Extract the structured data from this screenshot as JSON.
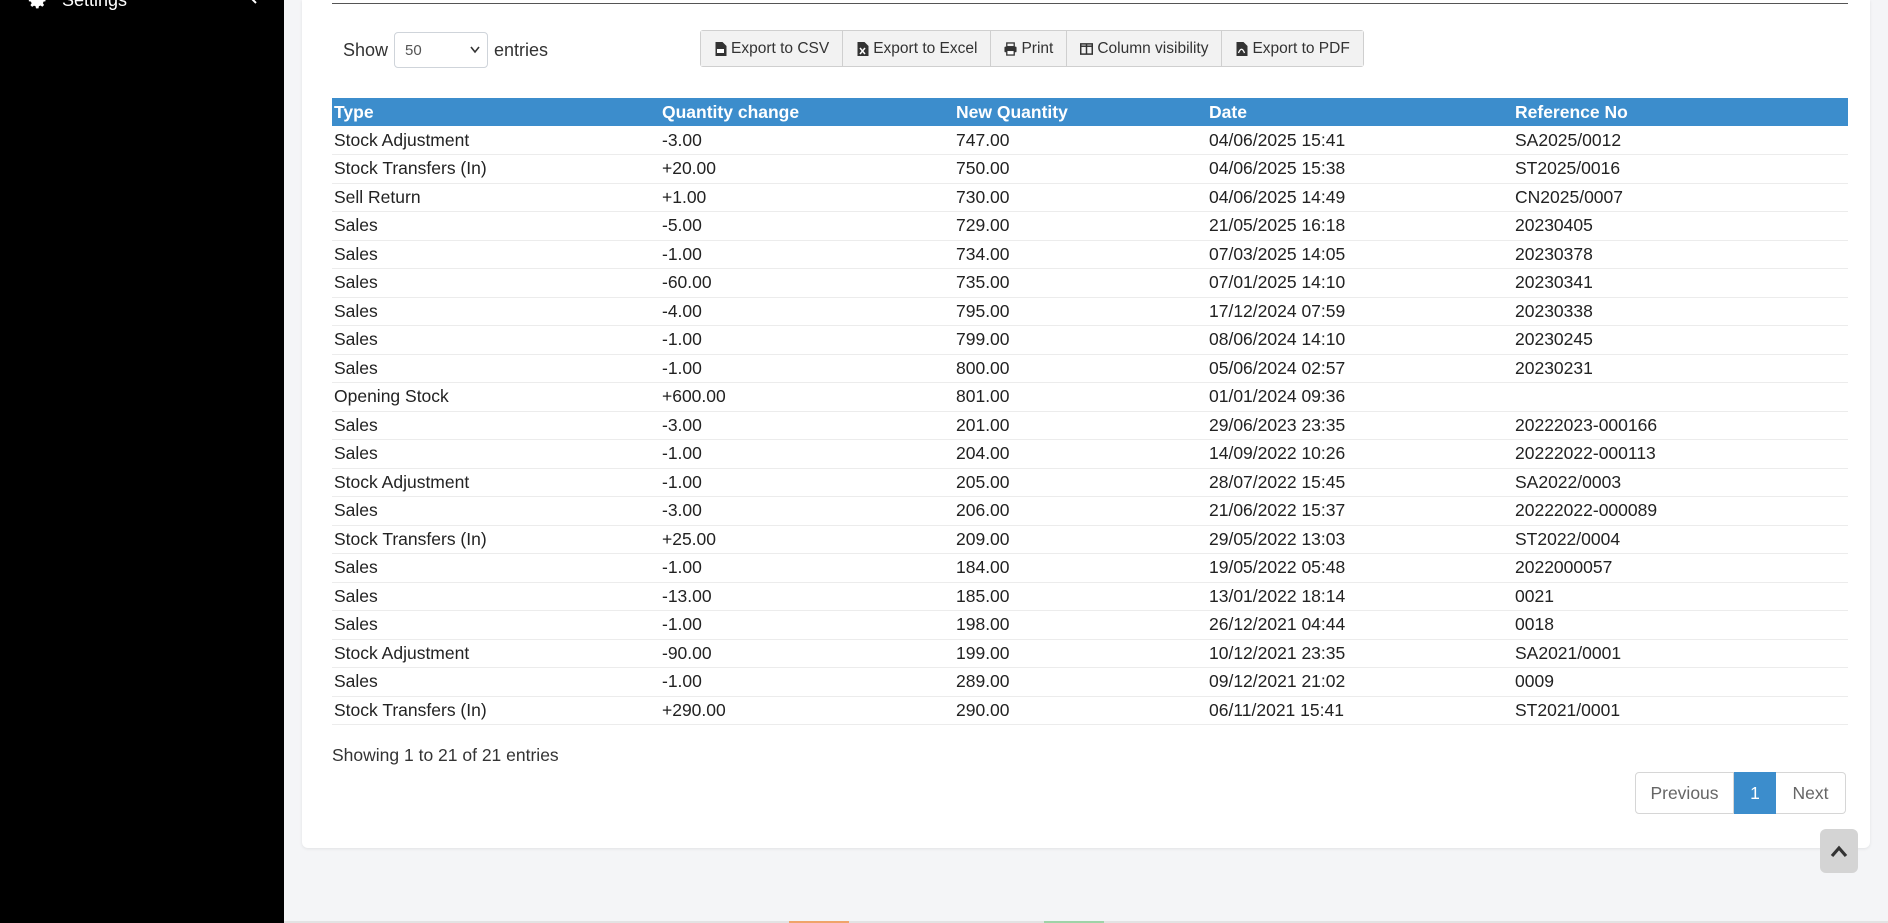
{
  "sidebar": {
    "settings_label": "Settings"
  },
  "table_controls": {
    "show_label": "Show",
    "entries_label": "entries",
    "page_length": "50"
  },
  "export_buttons": {
    "csv": "Export to CSV",
    "excel": "Export to Excel",
    "print": "Print",
    "column_visibility": "Column visibility",
    "pdf": "Export to PDF"
  },
  "table": {
    "headers": {
      "type": "Type",
      "quantity_change": "Quantity change",
      "new_quantity": "New Quantity",
      "date": "Date",
      "reference_no": "Reference No"
    },
    "rows": [
      {
        "type": "Stock Adjustment",
        "quantity_change": "-3.00",
        "new_quantity": "747.00",
        "date": "04/06/2025 15:41",
        "reference_no": "SA2025/0012"
      },
      {
        "type": "Stock Transfers (In)",
        "quantity_change": "+20.00",
        "new_quantity": "750.00",
        "date": "04/06/2025 15:38",
        "reference_no": "ST2025/0016"
      },
      {
        "type": "Sell Return",
        "quantity_change": "+1.00",
        "new_quantity": "730.00",
        "date": "04/06/2025 14:49",
        "reference_no": "CN2025/0007"
      },
      {
        "type": "Sales",
        "quantity_change": "-5.00",
        "new_quantity": "729.00",
        "date": "21/05/2025 16:18",
        "reference_no": "20230405"
      },
      {
        "type": "Sales",
        "quantity_change": "-1.00",
        "new_quantity": "734.00",
        "date": "07/03/2025 14:05",
        "reference_no": "20230378"
      },
      {
        "type": "Sales",
        "quantity_change": "-60.00",
        "new_quantity": "735.00",
        "date": "07/01/2025 14:10",
        "reference_no": "20230341"
      },
      {
        "type": "Sales",
        "quantity_change": "-4.00",
        "new_quantity": "795.00",
        "date": "17/12/2024 07:59",
        "reference_no": "20230338"
      },
      {
        "type": "Sales",
        "quantity_change": "-1.00",
        "new_quantity": "799.00",
        "date": "08/06/2024 14:10",
        "reference_no": "20230245"
      },
      {
        "type": "Sales",
        "quantity_change": "-1.00",
        "new_quantity": "800.00",
        "date": "05/06/2024 02:57",
        "reference_no": "20230231"
      },
      {
        "type": "Opening Stock",
        "quantity_change": "+600.00",
        "new_quantity": "801.00",
        "date": "01/01/2024 09:36",
        "reference_no": ""
      },
      {
        "type": "Sales",
        "quantity_change": "-3.00",
        "new_quantity": "201.00",
        "date": "29/06/2023 23:35",
        "reference_no": "20222023-000166"
      },
      {
        "type": "Sales",
        "quantity_change": "-1.00",
        "new_quantity": "204.00",
        "date": "14/09/2022 10:26",
        "reference_no": "20222022-000113"
      },
      {
        "type": "Stock Adjustment",
        "quantity_change": "-1.00",
        "new_quantity": "205.00",
        "date": "28/07/2022 15:45",
        "reference_no": "SA2022/0003"
      },
      {
        "type": "Sales",
        "quantity_change": "-3.00",
        "new_quantity": "206.00",
        "date": "21/06/2022 15:37",
        "reference_no": "20222022-000089"
      },
      {
        "type": "Stock Transfers (In)",
        "quantity_change": "+25.00",
        "new_quantity": "209.00",
        "date": "29/05/2022 13:03",
        "reference_no": "ST2022/0004"
      },
      {
        "type": "Sales",
        "quantity_change": "-1.00",
        "new_quantity": "184.00",
        "date": "19/05/2022 05:48",
        "reference_no": "2022000057"
      },
      {
        "type": "Sales",
        "quantity_change": "-13.00",
        "new_quantity": "185.00",
        "date": "13/01/2022 18:14",
        "reference_no": "0021"
      },
      {
        "type": "Sales",
        "quantity_change": "-1.00",
        "new_quantity": "198.00",
        "date": "26/12/2021 04:44",
        "reference_no": "0018"
      },
      {
        "type": "Stock Adjustment",
        "quantity_change": "-90.00",
        "new_quantity": "199.00",
        "date": "10/12/2021 23:35",
        "reference_no": "SA2021/0001"
      },
      {
        "type": "Sales",
        "quantity_change": "-1.00",
        "new_quantity": "289.00",
        "date": "09/12/2021 21:02",
        "reference_no": "0009"
      },
      {
        "type": "Stock Transfers (In)",
        "quantity_change": "+290.00",
        "new_quantity": "290.00",
        "date": "06/11/2021 15:41",
        "reference_no": "ST2021/0001"
      }
    ]
  },
  "footer": {
    "info": "Showing 1 to 21 of 21 entries",
    "pagination": {
      "previous": "Previous",
      "current_page": "1",
      "next": "Next"
    }
  },
  "colors": {
    "header_blue": "#3c8dcc",
    "sidebar_bg": "#000000"
  }
}
